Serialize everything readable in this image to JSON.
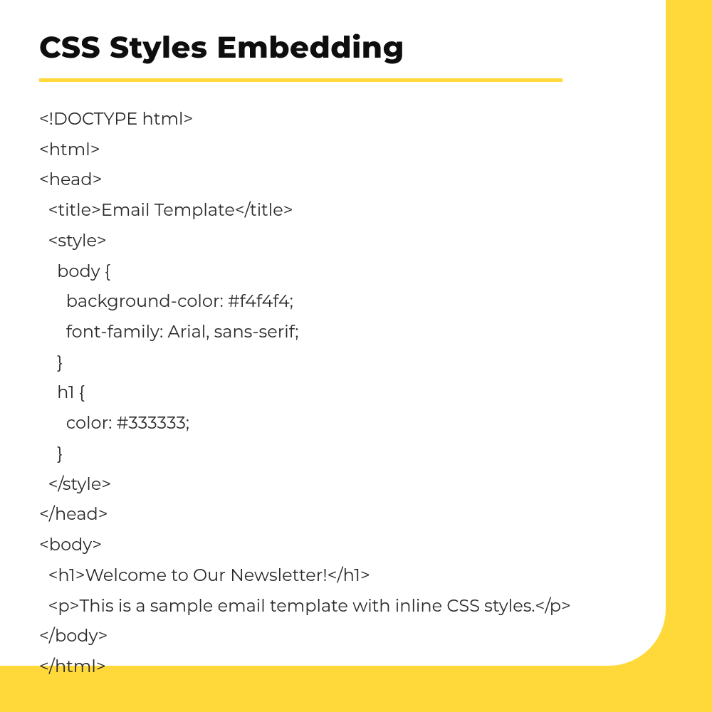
{
  "heading": "CSS Styles Embedding",
  "code": "<!DOCTYPE html>\n<html>\n<head>\n  <title>Email Template</title>\n  <style>\n    body {\n      background-color: #f4f4f4;\n      font-family: Arial, sans-serif;\n    }\n    h1 {\n      color: #333333;\n    }\n  </style>\n</head>\n<body>\n  <h1>Welcome to Our Newsletter!</h1>\n  <p>This is a sample email template with inline CSS styles.</p>\n</body>\n</html>"
}
